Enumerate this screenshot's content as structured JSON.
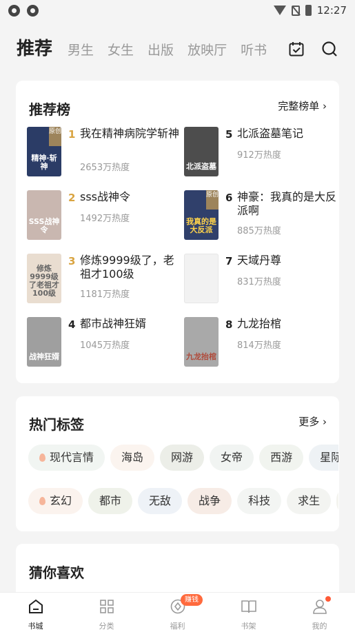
{
  "status_bar": {
    "time": "12:27"
  },
  "top_tabs": [
    "推荐",
    "男生",
    "女生",
    "出版",
    "放映厅",
    "听书"
  ],
  "ranking": {
    "title": "推荐榜",
    "more": "完整榜单 ›",
    "items": [
      {
        "rank": "1",
        "name": "我在精神病院学斩神",
        "heat": "2653万热度",
        "badge": "原创",
        "cover_text": "精神·斩神",
        "cover_color": "#2b3c66"
      },
      {
        "rank": "2",
        "name": "sss战神令",
        "heat": "1492万热度",
        "badge": "",
        "cover_text": "SSS战神令",
        "cover_color": "#c9b7b0"
      },
      {
        "rank": "3",
        "name": "修炼9999级了，老祖才100级",
        "heat": "1181万热度",
        "badge": "",
        "cover_text": "修炼9999级了老祖才100级",
        "cover_color": "#e9ddd0"
      },
      {
        "rank": "4",
        "name": "都市战神狂婿",
        "heat": "1045万热度",
        "badge": "",
        "cover_text": "战神狂婿",
        "cover_color": "#9f9f9f"
      },
      {
        "rank": "5",
        "name": "北派盗墓笔记",
        "heat": "912万热度",
        "badge": "",
        "cover_text": "北派盗墓",
        "cover_color": "#4d4d4d"
      },
      {
        "rank": "6",
        "name": "神豪：我真的是大反派啊",
        "heat": "885万热度",
        "badge": "原创",
        "cover_text": "我真的是大反派",
        "cover_color": "#30406b"
      },
      {
        "rank": "7",
        "name": "天域丹尊",
        "heat": "831万热度",
        "badge": "",
        "cover_text": "",
        "cover_color": "#f2f2f2"
      },
      {
        "rank": "8",
        "name": "九龙抬棺",
        "heat": "814万热度",
        "badge": "",
        "cover_text": "九龙抬棺",
        "cover_color": "#a9a9a9"
      }
    ]
  },
  "hot_tags": {
    "title": "热门标签",
    "more": "更多 ›",
    "row1": [
      "现代言情",
      "海岛",
      "网游",
      "女帝",
      "西游",
      "星际"
    ],
    "row2": [
      "玄幻",
      "都市",
      "无敌",
      "战争",
      "科技",
      "求生",
      ""
    ]
  },
  "guess": {
    "title": "猜你喜欢"
  },
  "bottom_nav": {
    "items": [
      "书城",
      "分类",
      "福利",
      "书架",
      "我的"
    ],
    "promo_badge": "赚钱"
  },
  "colors": {
    "rank_gold": "#d9a441",
    "rank_plain": "#222222",
    "promo": "#ff6a3d"
  }
}
